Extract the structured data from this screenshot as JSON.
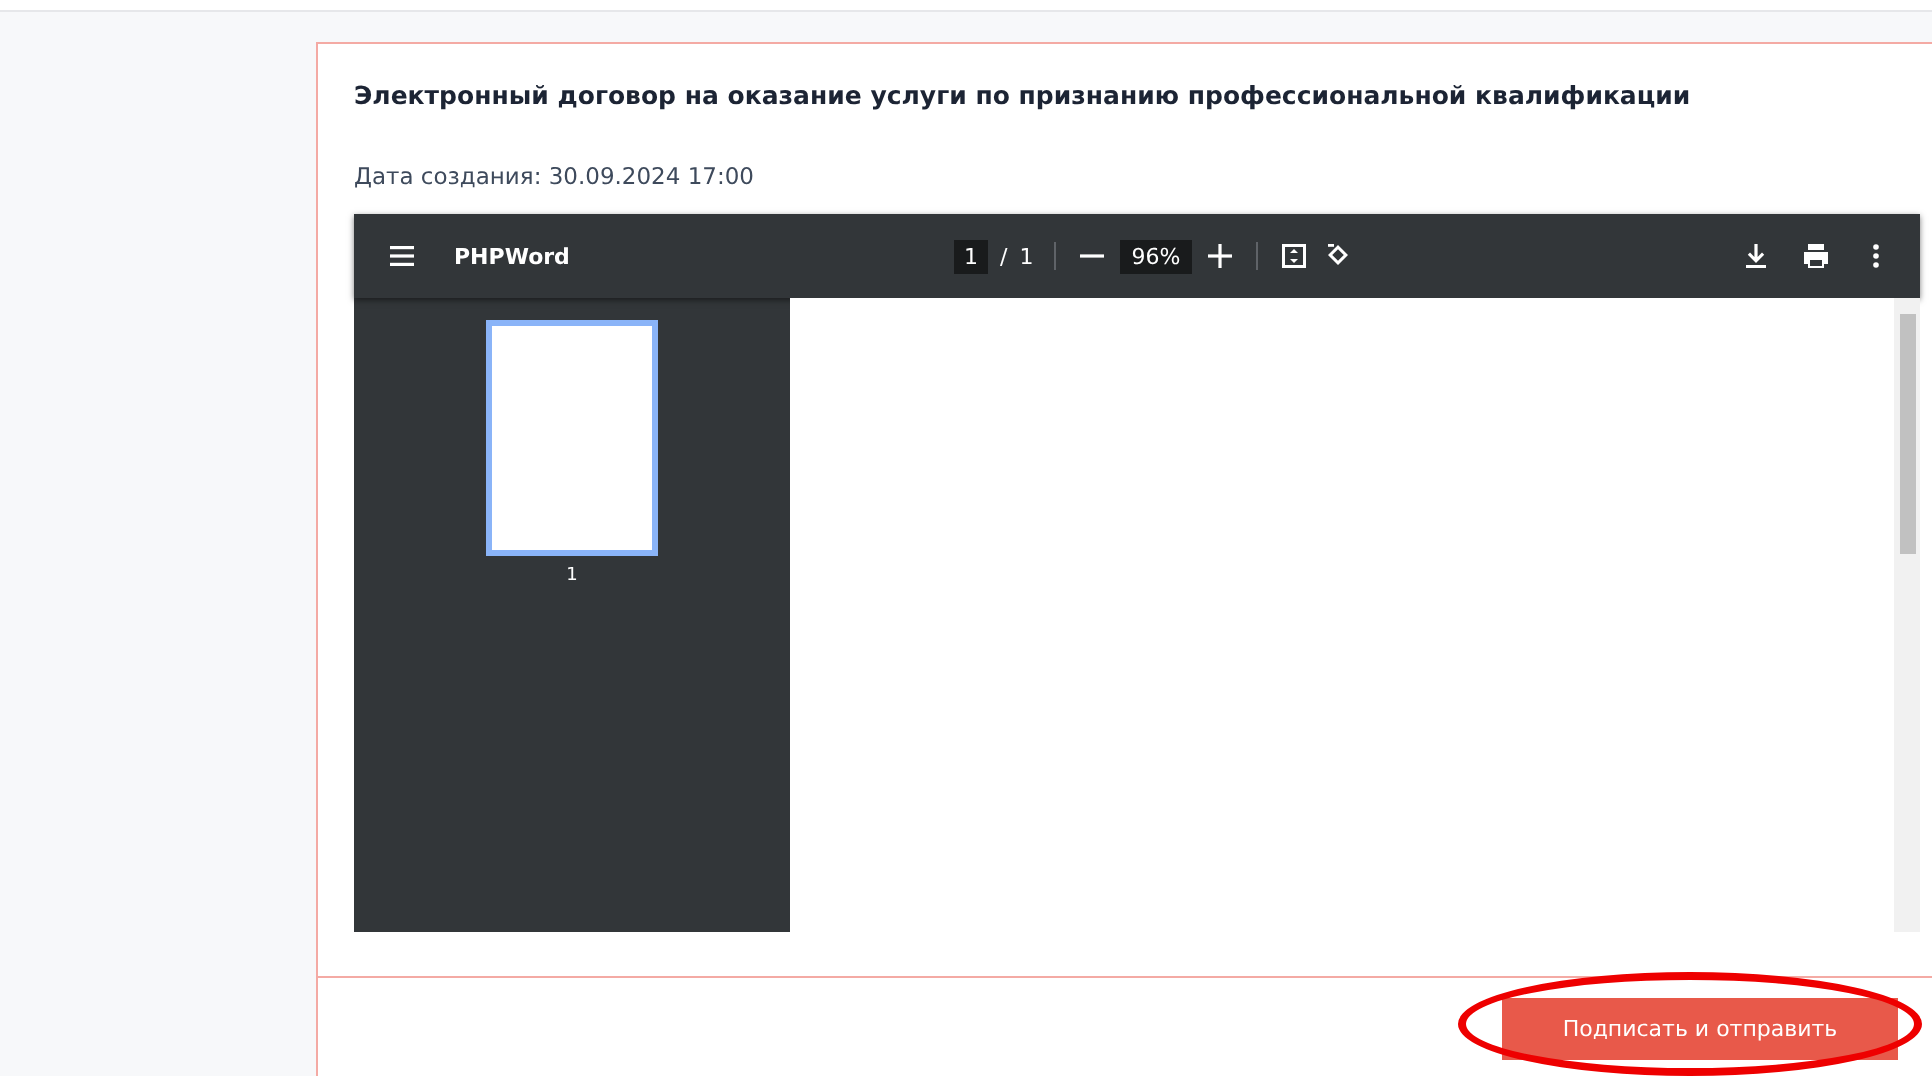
{
  "document": {
    "title": "Электронный договор на оказание услуги по признанию профессиональной квалификации",
    "created": "Дата создания: 30.09.2024 17:00"
  },
  "viewer": {
    "title": "PHPWord",
    "page": "1",
    "page_separator": "/",
    "page_count": "1",
    "zoom": "96%",
    "thumbnails": [
      {
        "label": "1",
        "selected": true
      }
    ]
  },
  "actions": [
    {
      "label": "Подписать и отправить",
      "highlighted": true
    }
  ]
}
